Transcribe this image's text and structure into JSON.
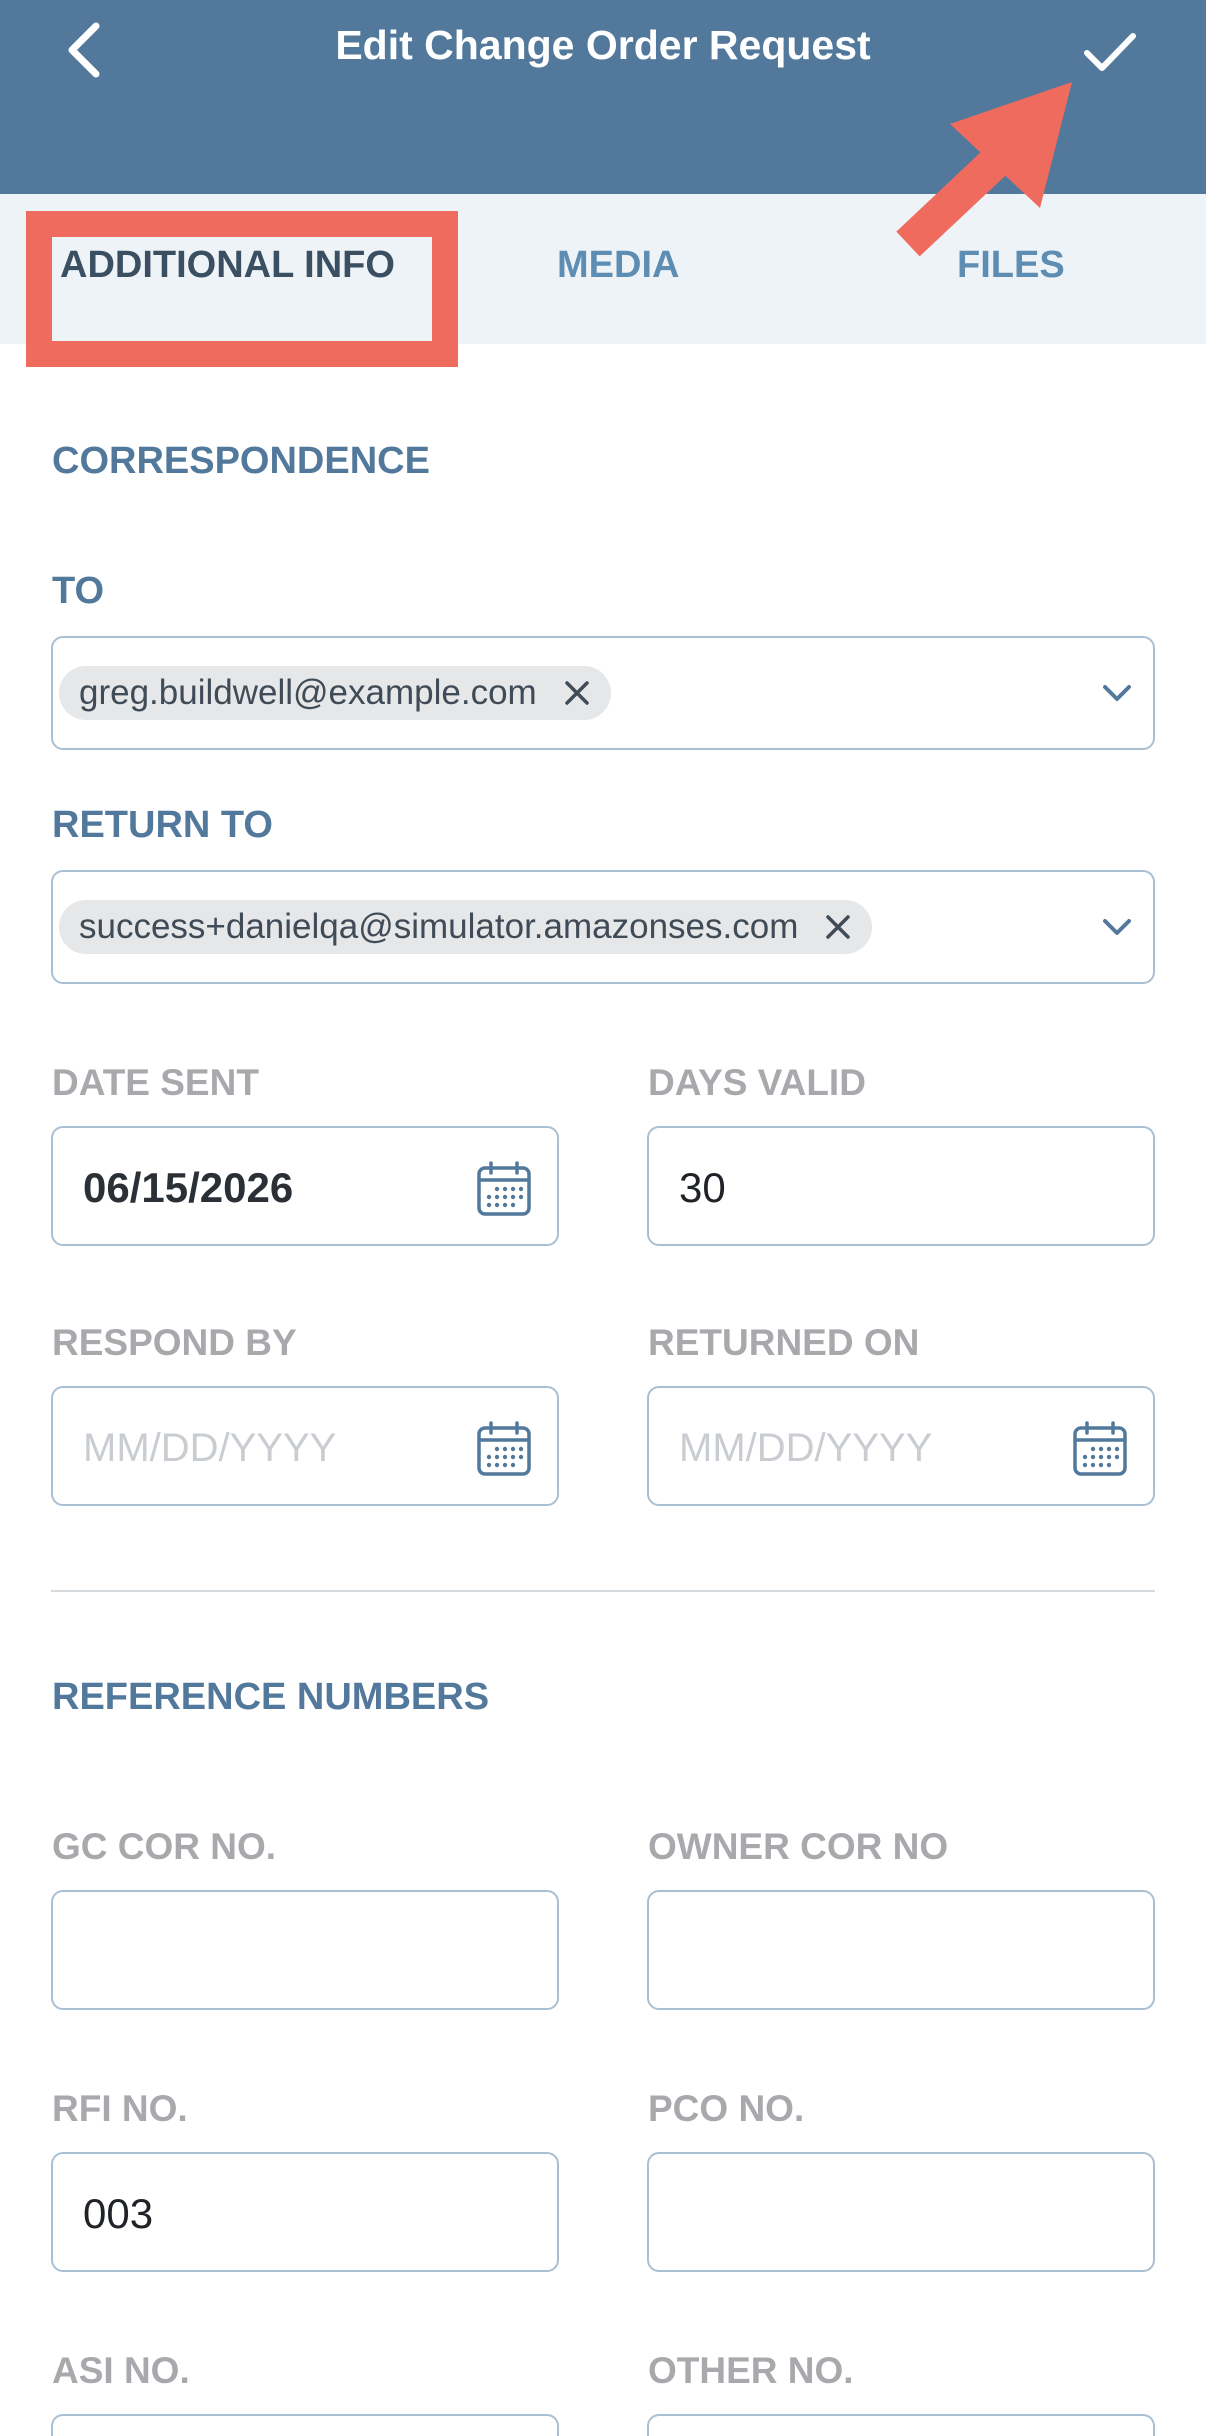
{
  "header": {
    "title": "Edit Change Order Request",
    "back_icon": "chevron-left-icon",
    "save_icon": "checkmark-icon",
    "background_color": "#52799c"
  },
  "tabs": [
    {
      "label": "ADDITIONAL INFO",
      "active": true
    },
    {
      "label": "MEDIA",
      "active": false
    },
    {
      "label": "FILES",
      "active": false
    }
  ],
  "annotation": {
    "color": "#ee6b5d"
  },
  "correspondence": {
    "section_title": "CORRESPONDENCE",
    "to_label": "TO",
    "to_chip": "greg.buildwell@example.com",
    "return_to_label": "RETURN TO",
    "return_to_chip": "success+danielqa@simulator.amazonses.com",
    "date_sent_label": "DATE SENT",
    "date_sent_value": "06/15/2026",
    "days_valid_label": "DAYS VALID",
    "days_valid_value": "30",
    "respond_by_label": "RESPOND BY",
    "respond_by_placeholder": "MM/DD/YYYY",
    "returned_on_label": "RETURNED ON",
    "returned_on_placeholder": "MM/DD/YYYY"
  },
  "reference_numbers": {
    "section_title": "REFERENCE NUMBERS",
    "gc_cor_label": "GC COR NO.",
    "gc_cor_value": "",
    "owner_cor_label": "OWNER COR NO",
    "owner_cor_value": "",
    "rfi_label": "RFI NO.",
    "rfi_value": "003",
    "pco_label": "PCO NO.",
    "pco_value": "",
    "asi_label": "ASI NO.",
    "other_label": "OTHER NO."
  }
}
